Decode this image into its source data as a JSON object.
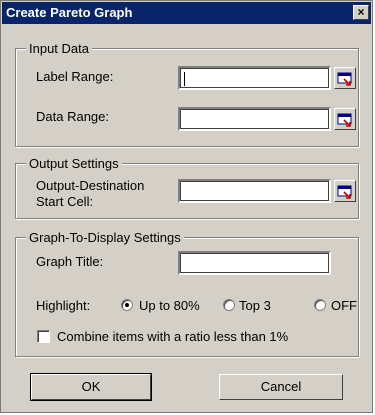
{
  "dialog": {
    "title": "Create Pareto Graph",
    "close_label": "×"
  },
  "input_data": {
    "legend": "Input Data",
    "label_range_label": "Label Range:",
    "label_range_value": "",
    "data_range_label": "Data Range:",
    "data_range_value": ""
  },
  "output_settings": {
    "legend": "Output Settings",
    "destination_label_line1": "Output-Destination",
    "destination_label_line2": "Start Cell:",
    "destination_value": ""
  },
  "graph_settings": {
    "legend": "Graph-To-Display Settings",
    "title_label": "Graph Title:",
    "title_value": "",
    "highlight_label": "Highlight:",
    "highlight_options": [
      "Up to 80%",
      "Top 3",
      "OFF"
    ],
    "highlight_selected": "Up to 80%",
    "combine_label": "Combine items with a ratio less than 1%",
    "combine_checked": false
  },
  "buttons": {
    "ok": "OK",
    "cancel": "Cancel"
  },
  "icons": {
    "ref": "range-select-icon",
    "close": "close-icon"
  }
}
